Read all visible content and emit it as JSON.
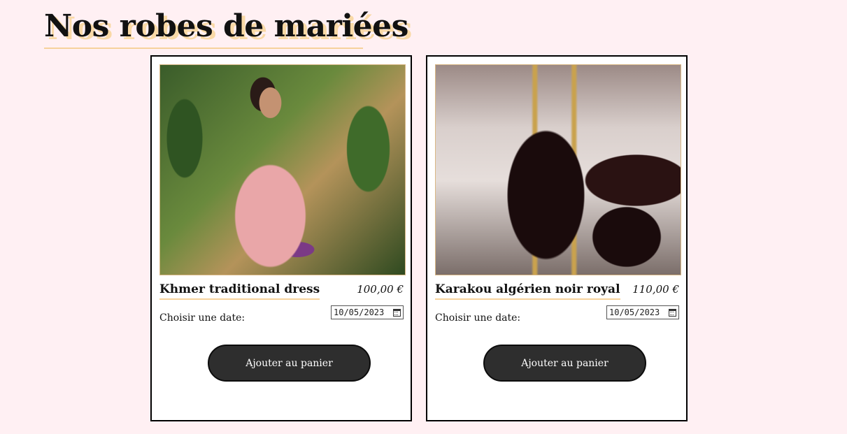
{
  "page": {
    "title": "Nos robes de mariées"
  },
  "products": [
    {
      "name": "Khmer traditional dress",
      "price": "100,00 €",
      "date_label": "Choisir une date:",
      "date_value": "10/05/2023",
      "button_label": "Ajouter au panier",
      "image": "khmer-dress-photo"
    },
    {
      "name": "Karakou algérien noir royal",
      "price": "110,00 €",
      "date_label": "Choisir une date:",
      "date_value": "10/05/2023",
      "button_label": "Ajouter au panier",
      "image": "karakou-dress-photo"
    }
  ],
  "colors": {
    "background": "#fff0f3",
    "accent": "#f6d29c",
    "button": "#2e2e2e"
  },
  "icons": {
    "date_picker": "calendar-icon"
  }
}
